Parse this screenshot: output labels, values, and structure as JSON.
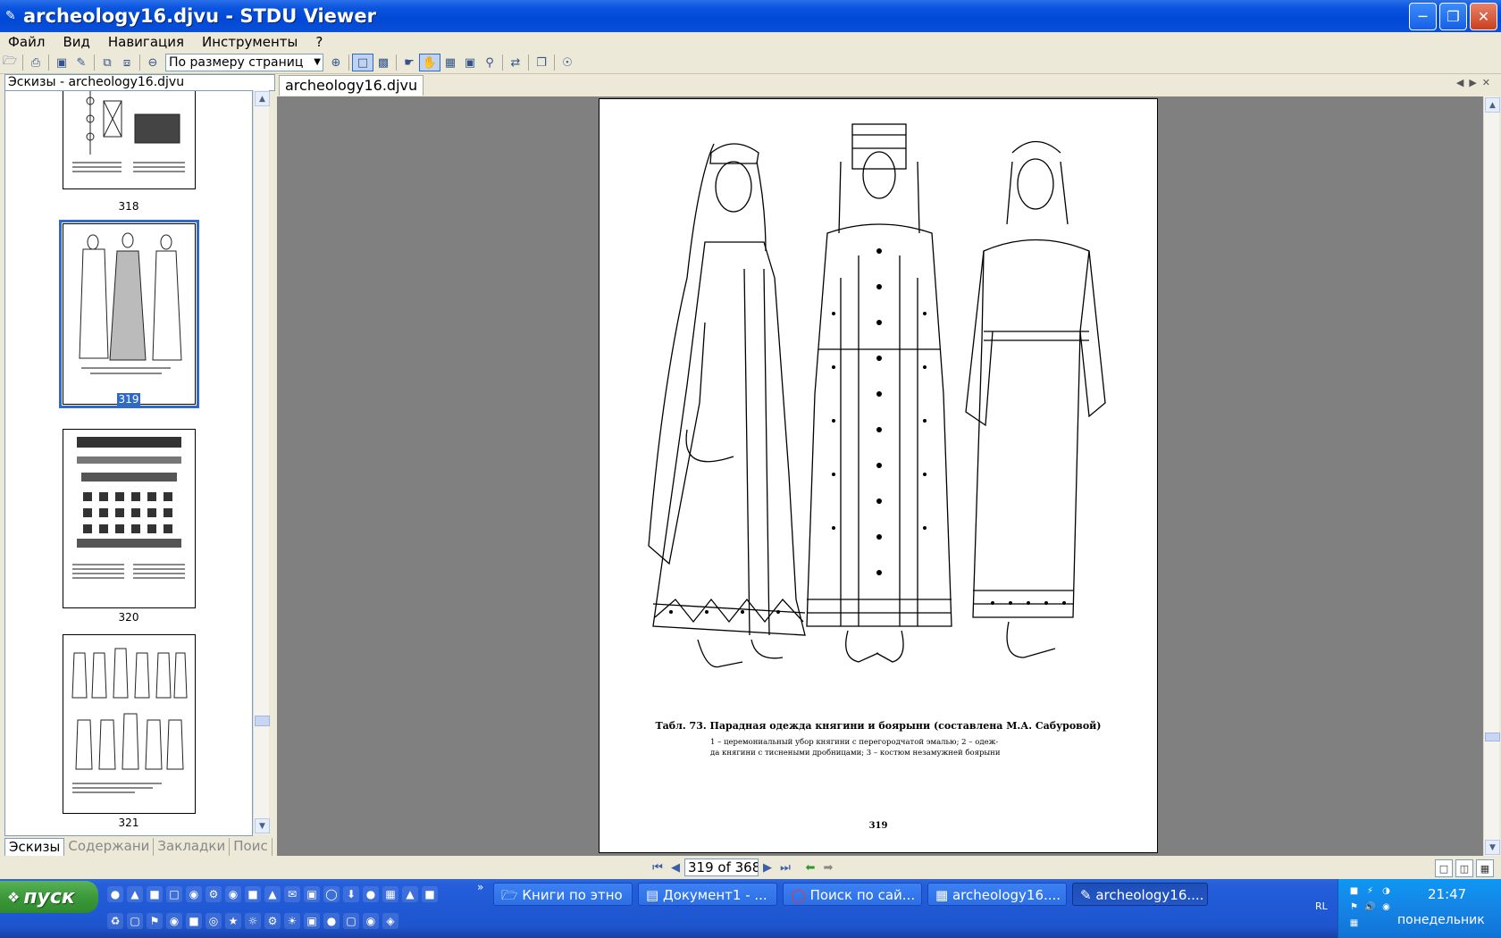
{
  "window": {
    "title": "archeology16.djvu - STDU Viewer"
  },
  "menu": {
    "items": [
      "Файл",
      "Вид",
      "Навигация",
      "Инструменты",
      "?"
    ]
  },
  "toolbar": {
    "zoom_value": "По размеру страниц"
  },
  "sidebar": {
    "header": "Эскизы - archeology16.djvu",
    "thumbnails": [
      {
        "page": "318",
        "selected": false
      },
      {
        "page": "319",
        "selected": true
      },
      {
        "page": "320",
        "selected": false
      },
      {
        "page": "321",
        "selected": false
      }
    ],
    "tabs": [
      "Эскизы",
      "Содержани",
      "Закладки",
      "Поис"
    ]
  },
  "document": {
    "tab_label": "archeology16.djvu",
    "caption_main": "Табл. 73. Парадная одежда княгини и боярыни (составлена М.А. Сабуровой)",
    "caption_line1": "1 – церемониальный убор княгини с перегородчатой эмалью; 2 – одеж-",
    "caption_line2": "да княгини с тиснеными дробницами; 3 – костюм незамужней боярыни",
    "page_number": "319"
  },
  "pagebar": {
    "page_field": "319 of 368"
  },
  "taskbar": {
    "start_label": "пуск",
    "tasks": [
      {
        "label": "Книги по этно",
        "icon": "folder-icon",
        "active": false
      },
      {
        "label": "Документ1 - ...",
        "icon": "word-icon",
        "active": false
      },
      {
        "label": "Поиск по сай...",
        "icon": "opera-icon",
        "active": false
      },
      {
        "label": "archeology16....",
        "icon": "winrar-icon",
        "active": false
      },
      {
        "label": "archeology16....",
        "icon": "stdu-icon",
        "active": true
      }
    ],
    "language": "RL",
    "clock": "21:47",
    "day": "понедельник"
  },
  "colors": {
    "titlebar": "#0a55e0",
    "taskbar": "#245edb",
    "selection": "#316ac5",
    "document_background": "#808080"
  }
}
